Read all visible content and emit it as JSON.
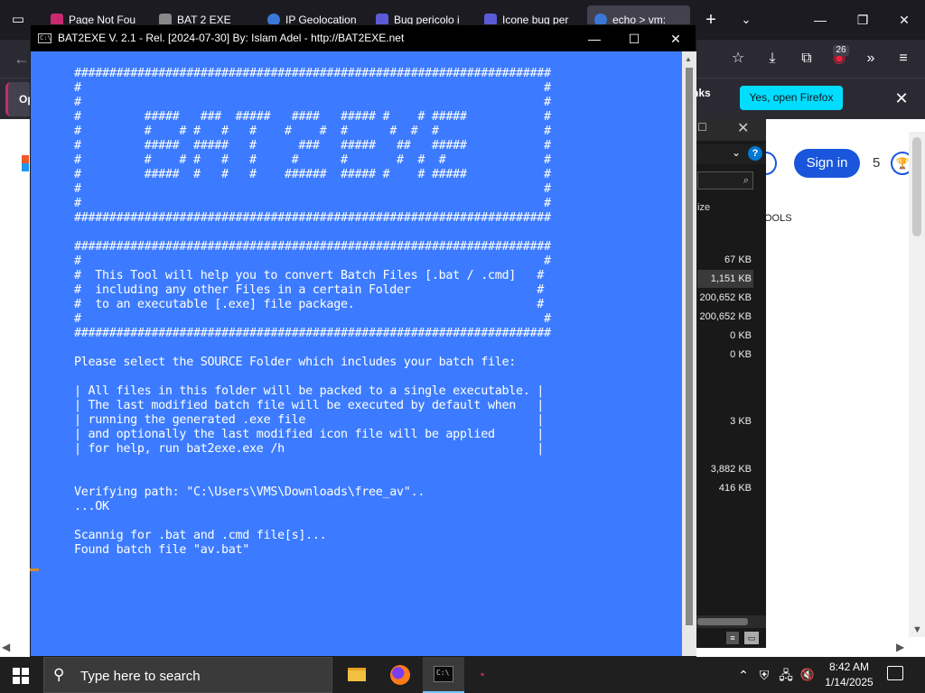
{
  "browser": {
    "tabs": [
      {
        "label": "Page Not Fou",
        "color": "#c82a6f"
      },
      {
        "label": "BAT 2 EXE",
        "color": "#888888"
      },
      {
        "label": "IP Geolocation",
        "color": "#3a78d8"
      },
      {
        "label": "Bug pericolo i",
        "color": "#5b5bd6"
      },
      {
        "label": "Icone bug per",
        "color": "#5b5bd6"
      },
      {
        "label": "echo > vm:",
        "color": "#3a78d8",
        "active": true
      }
    ],
    "new_tab": "+",
    "all_tabs": "⌄",
    "window_controls": {
      "minimize": "—",
      "maximize": "❐",
      "close": "✕"
    },
    "nav": {
      "back": "←",
      "bookmark": "☆",
      "downloads": "⤓",
      "extensions": "⧉",
      "extension_badge": "26",
      "overflow": "»",
      "menu": "≡"
    },
    "notification": {
      "left_label": "Op",
      "thanks": "nks",
      "yes_button": "Yes, open Firefox",
      "close": "✕"
    }
  },
  "webpage": {
    "sign_in": "Sign in",
    "count": "5",
    "tools": "OOLS"
  },
  "explorer": {
    "size_header": "ize",
    "sizes": [
      "67 KB",
      "1,151 KB",
      "200,652 KB",
      "200,652 KB",
      "0 KB",
      "0 KB",
      "3 KB",
      "3,882 KB",
      "416 KB"
    ],
    "selected_index": 1,
    "help": "?",
    "search_icon": "⌕"
  },
  "console": {
    "title": "BAT2EXE V. 2.1 - Rel. [2024-07-30] By: Islam Adel - http://BAT2EXE.net",
    "icon_text": "C:\\",
    "lines": [
      "####################################################################",
      "#                                                                  #",
      "#                                                                  #",
      "#         #####   ###  #####   ####   ##### #    # #####           #",
      "#         #    # #   #   #    #    #  #      #  #  #               #",
      "#         #####  #####   #      ###   #####   ##   #####           #",
      "#         #    # #   #   #     #      #       #  #  #              #",
      "#         #####  #   #   #    ######  ##### #    # #####           #",
      "#                                                                  #",
      "#                                                                  #",
      "####################################################################",
      "",
      "####################################################################",
      "#                                                                  #",
      "#  This Tool will help you to convert Batch Files [.bat / .cmd]   #",
      "#  including any other Files in a certain Folder                  #",
      "#  to an executable [.exe] file package.                          #",
      "#                                                                  #",
      "####################################################################",
      "",
      "Please select the SOURCE Folder which includes your batch file:",
      "",
      "| All files in this folder will be packed to a single executable. |",
      "| The last modified batch file will be executed by default when   |",
      "| running the generated .exe file                                 |",
      "| and optionally the last modified icon file will be applied      |",
      "| for help, run bat2exe.exe /h                                    |",
      "",
      "",
      "Verifying path: \"C:\\Users\\VMS\\Downloads\\free_av\"..",
      "...OK",
      "",
      "Scannig for .bat and .cmd file[s]...",
      "Found batch file \"av.bat\""
    ],
    "controls": {
      "minimize": "—",
      "maximize": "☐",
      "close": "✕"
    },
    "background": "#3c7bff"
  },
  "taskbar": {
    "search_placeholder": "Type here to search",
    "search_icon": "⚲",
    "time": "8:42 AM",
    "date": "1/14/2025",
    "tray_chevron": "⌃",
    "tray_volume": "🔇"
  }
}
